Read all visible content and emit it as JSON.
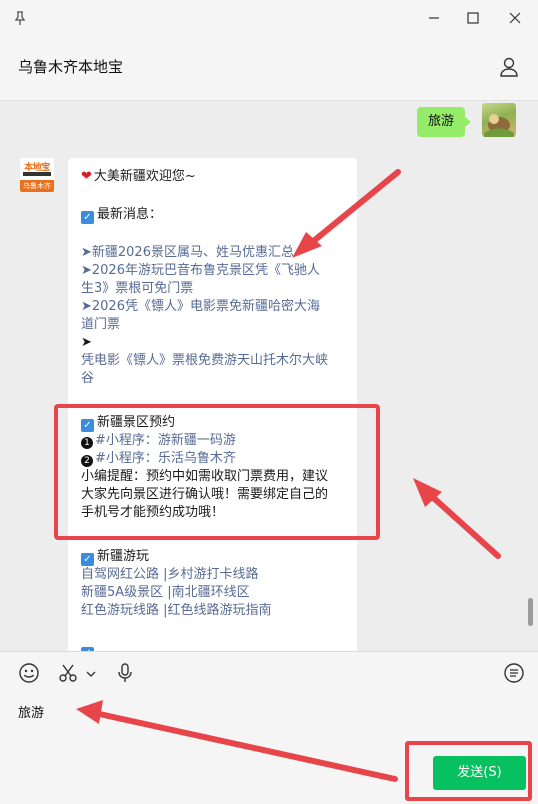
{
  "window": {
    "pin_icon": "pin-icon",
    "minimize_icon": "minimize-icon",
    "maximize_icon": "maximize-icon",
    "close_icon": "close-icon"
  },
  "header": {
    "title": "乌鲁木齐本地宝",
    "user_icon": "user-icon"
  },
  "chat": {
    "my_message": "旅游",
    "bot_avatar": {
      "top": "本地宝",
      "bottom": "乌鲁木齐"
    },
    "card": {
      "welcome": "大美新疆欢迎您~",
      "news_title": "最新消息：",
      "news": [
        "➤新疆2026景区属马、姓马优惠汇总",
        "➤2026年游玩巴音布鲁克景区凭《飞驰人",
        "生3》票根可免门票",
        "➤2026凭《镖人》电影票免新疆哈密大海",
        "道门票",
        "➤",
        "凭电影《镖人》票根免费游天山托木尔大峡",
        "谷"
      ],
      "booking_title": "新疆景区预约",
      "booking_items": [
        {
          "num": "❶",
          "text": "#小程序：游新疆一码游"
        },
        {
          "num": "❷",
          "text": "#小程序：乐活乌鲁木齐"
        }
      ],
      "tip_lines": [
        "小编提醒：预约中如需收取门票费用，建议",
        "大家先向景区进行确认哦！需要绑定自己的",
        "手机号才能预约成功哦！"
      ],
      "travel_title": "新疆游玩",
      "travel_lines": [
        "自驾网红公路 |乡村游打卡线路",
        "新疆5A级景区 |南北疆环线区",
        "红色游玩线路 |红色线路游玩指南"
      ]
    }
  },
  "input": {
    "toolbar": [
      "emoji-icon",
      "scissors-icon",
      "microphone-icon",
      "chat-history-icon"
    ],
    "text": "旅游",
    "send_label": "发送(S)"
  },
  "annotations": {
    "color": "#e8454b"
  },
  "colors": {
    "send": "#07c160",
    "my_bubble": "#95ec69",
    "link": "#576b95",
    "brand": "#e8711f"
  }
}
